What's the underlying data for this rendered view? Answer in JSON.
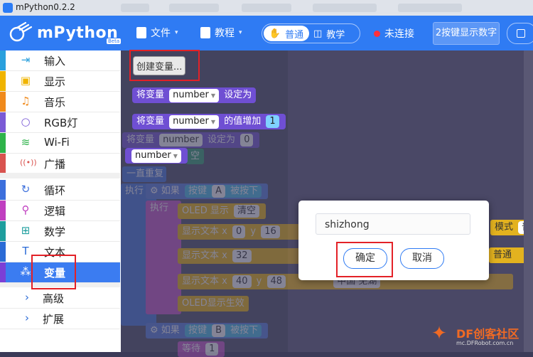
{
  "window": {
    "title": "mPython0.2.2"
  },
  "topbar": {
    "logo_text": "mPython",
    "logo_badge": "Beta",
    "file_menu": "文件",
    "tutorial_menu": "教程",
    "mode_normal": "普通",
    "mode_teaching": "教学",
    "connection_status": "未连接",
    "program_select": "2按键显示数字"
  },
  "sidebar": {
    "items": [
      {
        "label": "输入",
        "icon": "input-icon",
        "color": "#2aa0dd"
      },
      {
        "label": "显示",
        "icon": "display-icon",
        "color": "#f0b400"
      },
      {
        "label": "音乐",
        "icon": "music-icon",
        "color": "#f08a1c"
      },
      {
        "label": "RGB灯",
        "icon": "bulb-icon",
        "color": "#7b5bd6"
      },
      {
        "label": "Wi-Fi",
        "icon": "wifi-icon",
        "color": "#2eb34a"
      },
      {
        "label": "广播",
        "icon": "broadcast-icon",
        "color": "#d9534f"
      },
      {
        "label": "循环",
        "icon": "loop-icon",
        "color": "#3c6fdc"
      },
      {
        "label": "逻辑",
        "icon": "logic-icon",
        "color": "#c03fc0"
      },
      {
        "label": "数学",
        "icon": "math-icon",
        "color": "#1e9e9e"
      },
      {
        "label": "文本",
        "icon": "text-icon",
        "color": "#2b6bd6"
      },
      {
        "label": "变量",
        "icon": "variable-icon",
        "color": "#7b3fd6"
      },
      {
        "label": "高级",
        "icon": "chevron-right-icon",
        "color": "#2b6bd6"
      },
      {
        "label": "扩展",
        "icon": "chevron-right-icon",
        "color": "#2b6bd6"
      }
    ]
  },
  "flyout": {
    "create_variable": "创建变量...",
    "set_prefix": "将变量",
    "var_name": "number",
    "set_suffix": "设定为",
    "change_suffix": "的值增加",
    "change_value": "1"
  },
  "workspace": {
    "set_var": "将变量",
    "var_name": "number",
    "set_to": "设定为",
    "set_value": "0",
    "empty_word": "空",
    "forever": "一直重复",
    "exec": "执行",
    "if": "如果",
    "button": "按键",
    "button_a": "A",
    "button_b": "B",
    "pressed": "被按下",
    "oled_show": "OLED 显示",
    "clear": "清空",
    "show_text": "显示文本 x",
    "x1": "0",
    "y_label": "y",
    "y1": "16",
    "x2": "32",
    "x3": "40",
    "y3": "48",
    "chinese_text": "中国 芜湖",
    "mode_label": "模式",
    "normal": "普通",
    "oled_effect": "OLED显示生效",
    "wait": "等待",
    "wait_value": "1"
  },
  "dialog": {
    "input_value": "shizhong",
    "ok_label": "确定",
    "cancel_label": "取消"
  },
  "watermark": {
    "brand": "DF创客社区",
    "url": "mc.DFRobot.com.cn"
  }
}
